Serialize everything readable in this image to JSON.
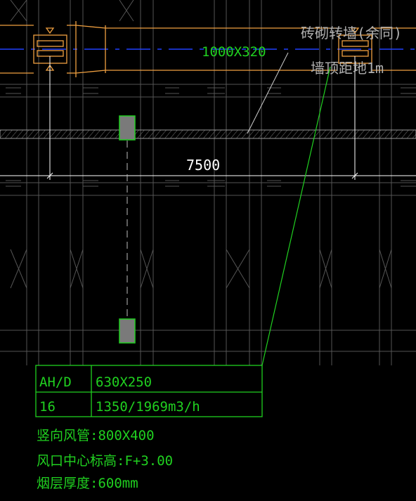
{
  "colors": {
    "background": "#000000",
    "gridline": "#5a5a5a",
    "duct": "#f0a040",
    "duct_label": "#20d020",
    "centerline": "#2040ff",
    "note_text": "#b0b0b0",
    "dimension": "#ffffff",
    "table": "#20d020",
    "column": "#808080"
  },
  "drawing": {
    "duct_size_label": "1000X320",
    "wall_note_line1": "砖砌转墙(余同)",
    "wall_note_line2": "墙顶距地1m",
    "dimension_label": "7500"
  },
  "table": {
    "rows": [
      {
        "col1": "AH/D",
        "col2": "630X250"
      },
      {
        "col1": "16",
        "col2": "1350/1969m3/h"
      }
    ]
  },
  "notes": {
    "line1": "竖向风管:800X400",
    "line2": "风口中心标高:F+3.00",
    "line3": "烟层厚度:600mm"
  }
}
